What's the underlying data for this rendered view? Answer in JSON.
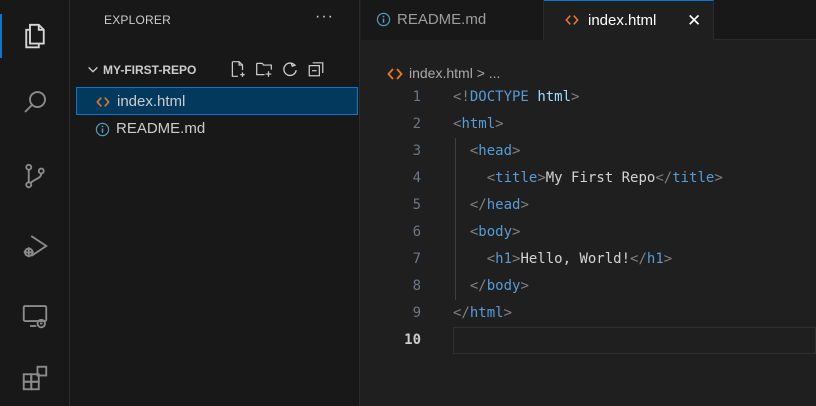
{
  "activity_bar": {
    "items": [
      {
        "name": "explorer-icon",
        "active": true
      },
      {
        "name": "search-icon",
        "active": false
      },
      {
        "name": "source-control-icon",
        "active": false
      },
      {
        "name": "run-debug-icon",
        "active": false
      },
      {
        "name": "remote-explorer-icon",
        "active": false
      },
      {
        "name": "extensions-icon",
        "active": false
      }
    ]
  },
  "sidebar": {
    "title": "EXPLORER",
    "more": "···",
    "section_title": "MY-FIRST-REPO",
    "section_actions": [
      "new-file-icon",
      "new-folder-icon",
      "refresh-icon",
      "collapse-all-icon"
    ],
    "files": [
      {
        "label": "index.html",
        "icon": "html-file-icon",
        "selected": true
      },
      {
        "label": "README.md",
        "icon": "info-icon",
        "selected": false
      }
    ]
  },
  "tabs": [
    {
      "label": "README.md",
      "icon": "info-icon",
      "active": false
    },
    {
      "label": "index.html",
      "icon": "html-file-icon",
      "active": true,
      "close": "✕"
    }
  ],
  "breadcrumb": {
    "text": "index.html > ..."
  },
  "editor": {
    "active_line": 10,
    "lines": [
      {
        "n": "1",
        "text": "<!DOCTYPE html>"
      },
      {
        "n": "2",
        "text": "<html>"
      },
      {
        "n": "3",
        "text": "  <head>"
      },
      {
        "n": "4",
        "text": "    <title>My First Repo</title>"
      },
      {
        "n": "5",
        "text": "  </head>"
      },
      {
        "n": "6",
        "text": "  <body>"
      },
      {
        "n": "7",
        "text": "    <h1>Hello, World!</h1>"
      },
      {
        "n": "8",
        "text": "  </body>"
      },
      {
        "n": "9",
        "text": "</html>"
      },
      {
        "n": "10",
        "text": ""
      }
    ]
  },
  "colors": {
    "accent": "#0078d4",
    "tag": "#569cd6",
    "selection_bg": "#04395e",
    "html_icon": "#e37933",
    "info_icon": "#519aba"
  }
}
